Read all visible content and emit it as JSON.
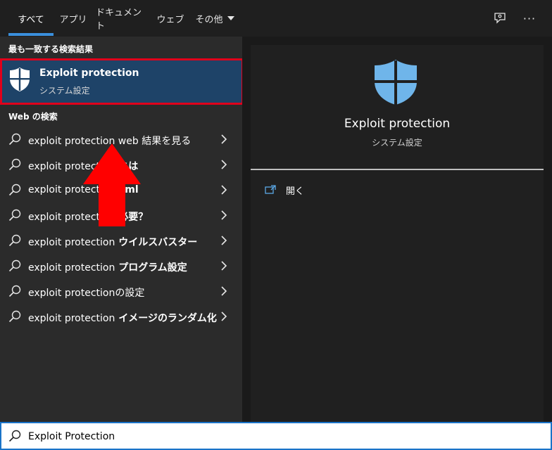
{
  "tabs": [
    {
      "label": "すべて"
    },
    {
      "label": "アプリ"
    },
    {
      "label": "ドキュメント"
    },
    {
      "label": "ウェブ"
    },
    {
      "label": "その他"
    }
  ],
  "top_icons": {
    "feedback": "feedback-icon",
    "more": "···"
  },
  "best_match": {
    "heading": "最も一致する検索結果",
    "title": "Exploit protection",
    "subtitle": "システム設定",
    "icon": "shield-icon"
  },
  "web": {
    "heading": "Web の検索",
    "results": [
      {
        "prefix": "exploit protection",
        "suffix": " web 結果を見る",
        "bold": false
      },
      {
        "prefix": "exploit protection",
        "suffix": " とは",
        "bold": true
      },
      {
        "prefix": "exploit protection",
        "suffix": " xml",
        "bold": true
      },
      {
        "prefix": "exploit protection",
        "suffix": " 必要？",
        "bold": true
      },
      {
        "prefix": "exploit protection",
        "suffix": " ウイルスバスター",
        "bold": true
      },
      {
        "prefix": "exploit protection",
        "suffix": " プログラム設定",
        "bold": true
      },
      {
        "prefix": "exploit protection",
        "suffix": "の設定",
        "bold": false
      },
      {
        "prefix": "exploit protection",
        "suffix": " イメージのランダム化",
        "bold": true
      }
    ]
  },
  "preview": {
    "title": "Exploit protection",
    "subtitle": "システム設定",
    "open_label": "開く"
  },
  "search": {
    "value": "Exploit Protection"
  },
  "colors": {
    "accent": "#3a8fdc",
    "highlight_border": "#e0001b",
    "selected_bg": "#1e4368",
    "annotation_arrow": "#ff0000"
  }
}
